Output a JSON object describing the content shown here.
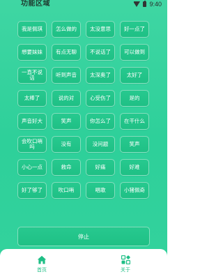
{
  "status_bar": {
    "title": "功能区域",
    "time": "9:40"
  },
  "buttons": [
    "我是佩琪",
    "怎么做的",
    "太没意思",
    "好一点了",
    "想要妹妹",
    "有点无聊",
    "不说话了",
    "可以做到",
    "一直不说话",
    "听到声音",
    "太深奥了",
    "太好了",
    "太棒了",
    "说的对",
    "心受伤了",
    "是的",
    "声音好大",
    "笑声",
    "你怎么了",
    "在干什么",
    "会吹口哨吗",
    "没有",
    "没问题",
    "笑声",
    "小心一点",
    "救命",
    "好痛",
    "好难",
    "好了够了",
    "吹口哨",
    "唱歌",
    "小猪佩奇"
  ],
  "stop_label": "停止",
  "nav": {
    "home_label": "首页",
    "about_label": "关于"
  },
  "colors": {
    "accent": "#2ed09a",
    "button": "#22c48a",
    "nav_text": "#1fbf86"
  },
  "icons": {
    "home": "home-icon",
    "about": "grid-app-icon",
    "wifi": "wifi-icon",
    "battery": "battery-icon"
  }
}
